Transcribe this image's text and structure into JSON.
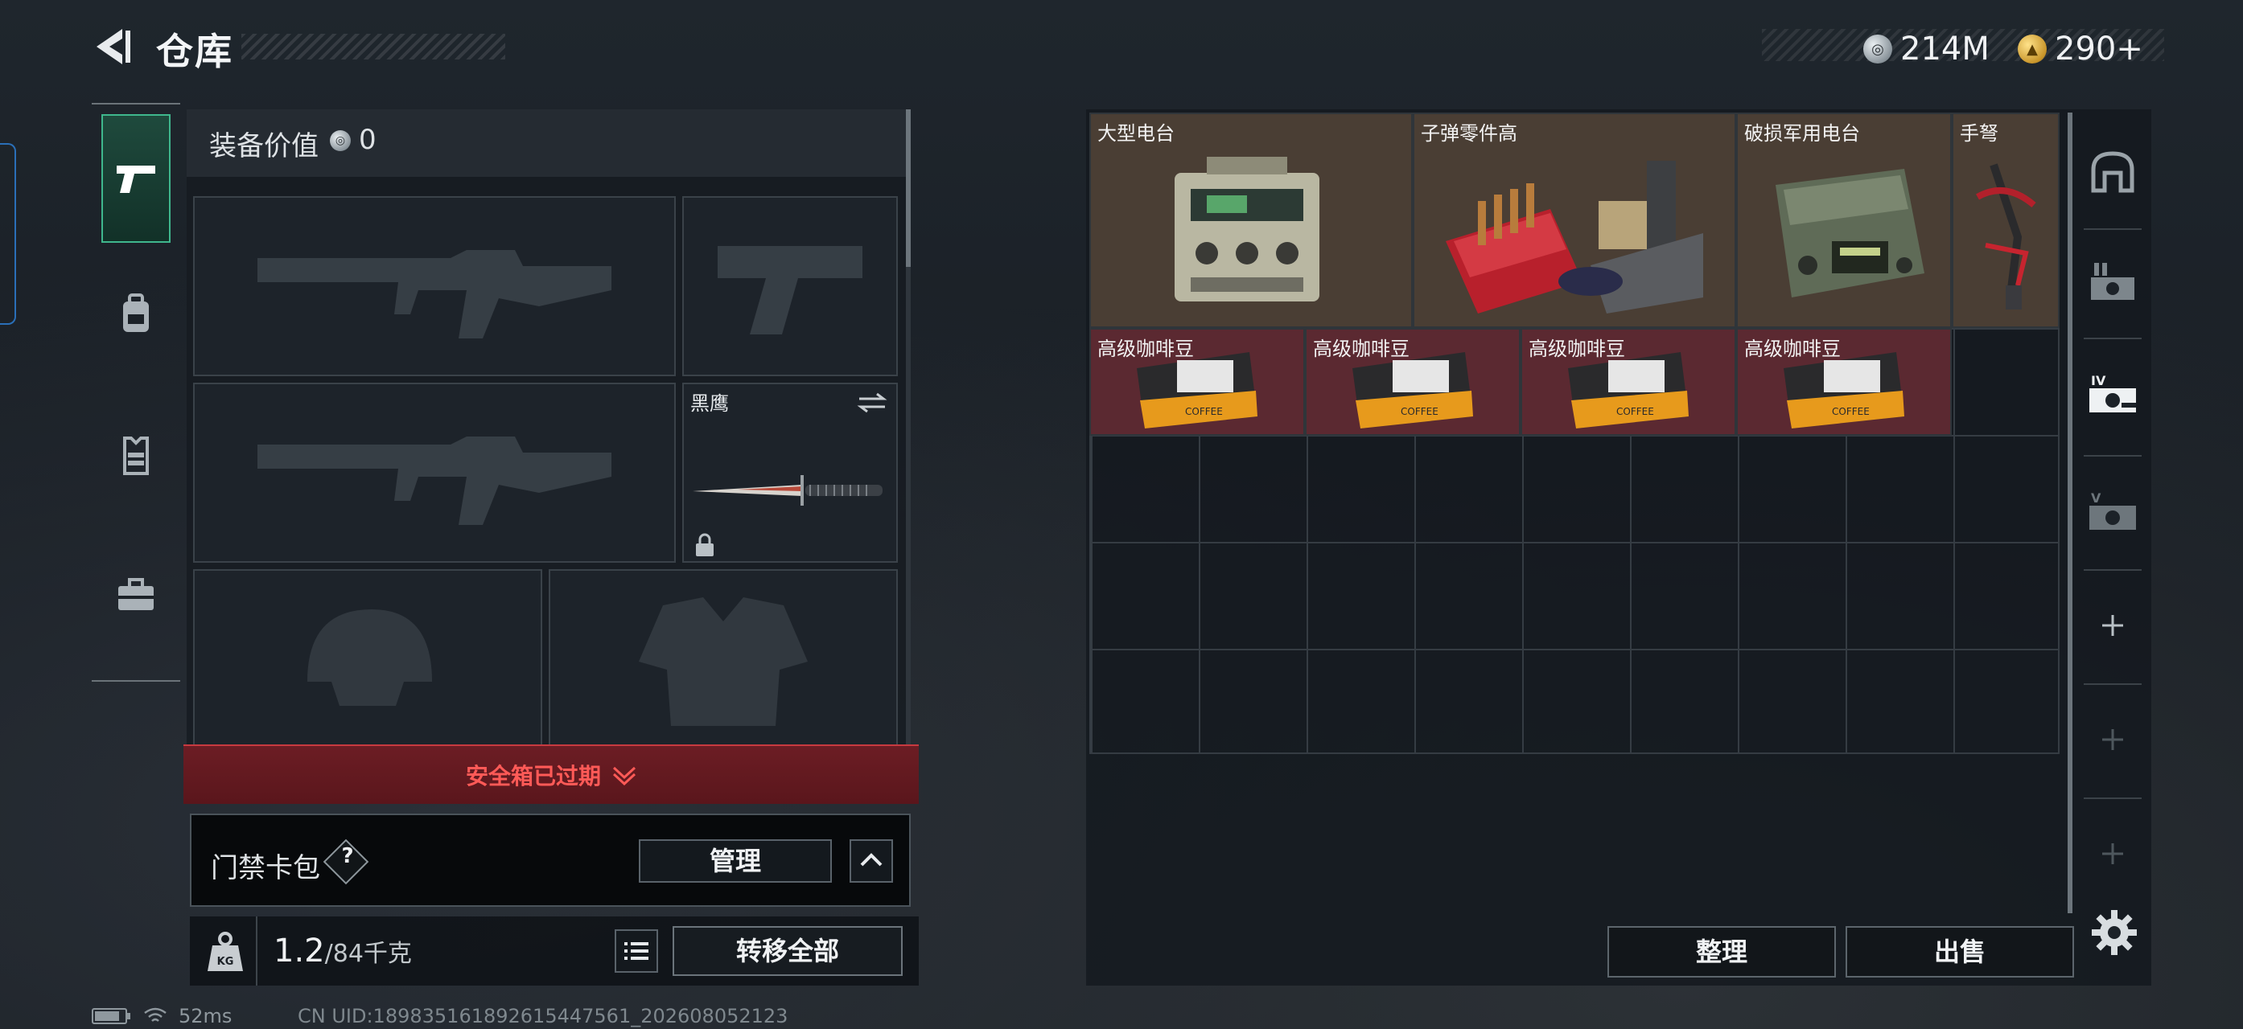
{
  "header": {
    "title": "仓库",
    "currency": [
      {
        "icon": "silver-coin-icon",
        "value": "214M"
      },
      {
        "icon": "gold-coin-icon",
        "value": "290+"
      }
    ]
  },
  "tabs": [
    {
      "name": "weapon-tab",
      "icon": "pistol-icon",
      "active": true
    },
    {
      "name": "backpack-tab",
      "icon": "backpack-icon",
      "active": false
    },
    {
      "name": "vest-tab",
      "icon": "vest-icon",
      "active": false
    },
    {
      "name": "toolbox-tab",
      "icon": "briefcase-icon",
      "active": false
    }
  ],
  "equipment": {
    "value_label": "装备价值",
    "value": "0",
    "melee_name": "黑鹰",
    "safebox_notice": "安全箱已过期",
    "keycard_label": "门禁卡包",
    "help_label": "?",
    "manage_label": "管理",
    "weight_current": "1.2",
    "weight_max": "/84千克",
    "transfer_all_label": "转移全部"
  },
  "inventory": {
    "items": [
      {
        "name": "大型电台",
        "bg": "brown",
        "icon": "radio-icon"
      },
      {
        "name": "子弹零件高",
        "bg": "brown",
        "icon": "ammo-parts-icon"
      },
      {
        "name": "破损军用电台",
        "bg": "brown",
        "icon": "military-radio-icon"
      },
      {
        "name": "手弩",
        "bg": "brown",
        "icon": "crossbow-icon"
      },
      {
        "name": "高级咖啡豆",
        "bg": "red",
        "icon": "coffee-bag-icon"
      },
      {
        "name": "高级咖啡豆",
        "bg": "red",
        "icon": "coffee-bag-icon"
      },
      {
        "name": "高级咖啡豆",
        "bg": "red",
        "icon": "coffee-bag-icon"
      },
      {
        "name": "高级咖啡豆",
        "bg": "red",
        "icon": "coffee-bag-icon"
      }
    ],
    "sort_label": "整理",
    "sell_label": "出售"
  },
  "side_buttons": [
    "helmet-slot-icon",
    "storage-1-icon",
    "storage-2-icon",
    "storage-3-icon",
    "add-icon",
    "add-icon",
    "add-icon"
  ],
  "status": {
    "ping": "52ms",
    "uid": "CN UID:1898351618926154475​61_202608052123"
  },
  "colors": {
    "accent_green": "#3fb78d",
    "warning_red": "#ff5a57",
    "rare_brown": "#4a3e34",
    "epic_red": "#5b2931"
  }
}
